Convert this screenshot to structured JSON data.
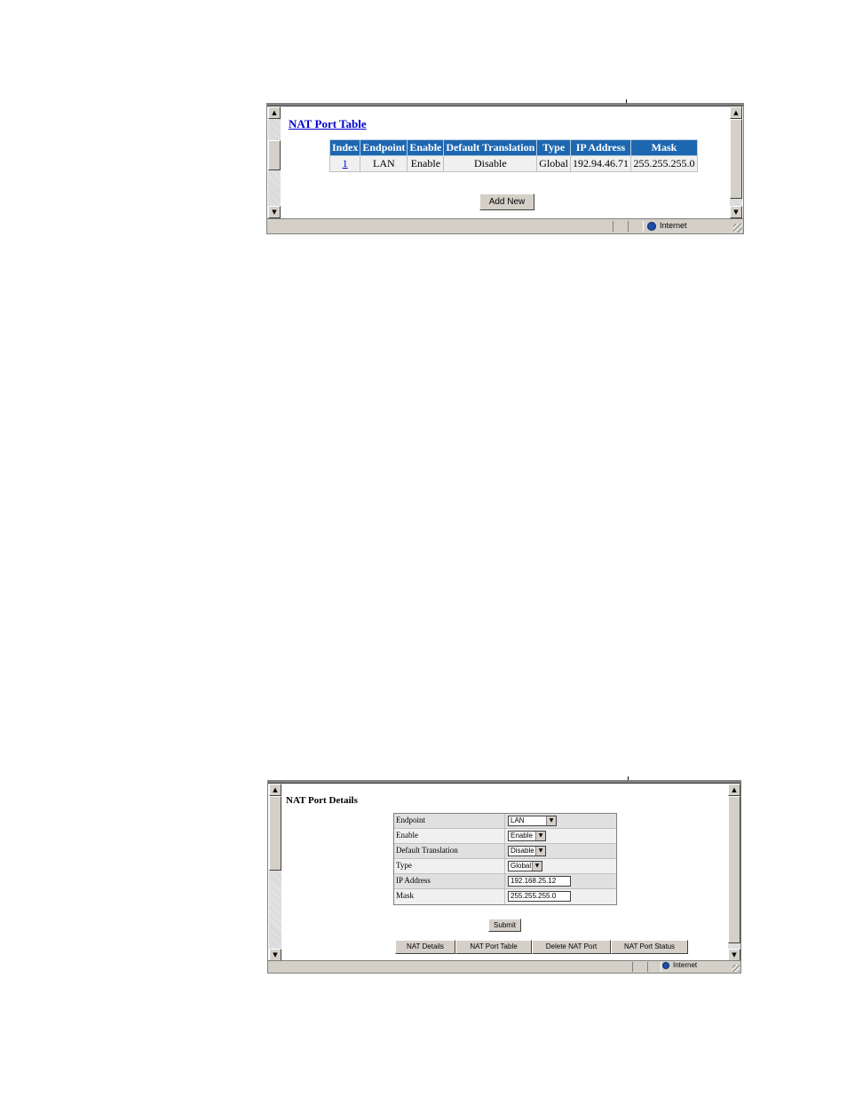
{
  "window1": {
    "title": "NAT Port Table",
    "columns": [
      "Index",
      "Endpoint",
      "Enable",
      "Default Translation",
      "Type",
      "IP Address",
      "Mask"
    ],
    "rows": [
      {
        "index": "1",
        "endpoint": "LAN",
        "enable": "Enable",
        "default_translation": "Disable",
        "type": "Global",
        "ip_address": "192.94.46.71",
        "mask": "255.255.255.0"
      }
    ],
    "add_new_label": "Add New",
    "status_zone": "Internet"
  },
  "window2": {
    "title": "NAT Port Details",
    "fields": {
      "endpoint": {
        "label": "Endpoint",
        "value": "LAN"
      },
      "enable": {
        "label": "Enable",
        "value": "Enable"
      },
      "default_translation": {
        "label": "Default Translation",
        "value": "Disable"
      },
      "type": {
        "label": "Type",
        "value": "Global"
      },
      "ip_address": {
        "label": "IP Address",
        "value": "192.168.25.12"
      },
      "mask": {
        "label": "Mask",
        "value": "255.255.255.0"
      }
    },
    "submit_label": "Submit",
    "nav": {
      "nat_details": "NAT Details",
      "nat_port_table": "NAT Port Table",
      "delete_nat_port": "Delete NAT Port",
      "nat_port_status": "NAT Port Status"
    },
    "status_zone": "Internet"
  },
  "icons": {
    "scroll_up": "▲",
    "scroll_down": "▼",
    "dropdown": "▼"
  }
}
